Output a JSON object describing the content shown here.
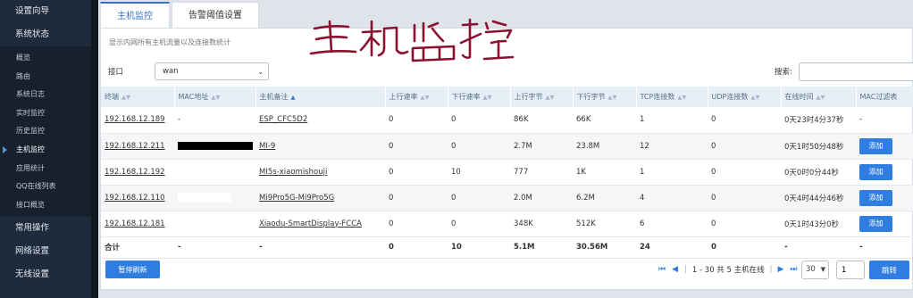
{
  "sidebar": {
    "top": [
      {
        "label": "设置向导"
      },
      {
        "label": "系统状态"
      }
    ],
    "subs": [
      {
        "label": "概览"
      },
      {
        "label": "路由"
      },
      {
        "label": "系统日志"
      },
      {
        "label": "实时监控"
      },
      {
        "label": "历史监控"
      },
      {
        "label": "主机监控"
      },
      {
        "label": "应用统计"
      },
      {
        "label": "QQ在线列表"
      },
      {
        "label": "接口概览"
      }
    ],
    "bottom": [
      {
        "label": "常用操作"
      },
      {
        "label": "网络设置"
      },
      {
        "label": "无线设置"
      }
    ]
  },
  "tabs": [
    "主机监控",
    "告警阈值设置"
  ],
  "description": "显示内网所有主机流量以及连接数统计",
  "handwriting": "主机监控",
  "filter": {
    "interface_label": "接口",
    "interface_value": "wan",
    "search_label": "搜索:",
    "search_value": ""
  },
  "table": {
    "headers": [
      "终端",
      "MAC地址",
      "主机备注",
      "上行速率",
      "下行速率",
      "上行字节",
      "下行字节",
      "TCP连接数",
      "UDP连接数",
      "在线时间",
      "MAC过滤表"
    ],
    "rows": [
      {
        "ip": "192.168.12.189",
        "mac": "-",
        "note": "ESP_CFC5D2",
        "up_rate": "0",
        "down_rate": "0",
        "up_bytes": "86K",
        "down_bytes": "66K",
        "tcp": "1",
        "udp": "0",
        "online": "0天23时4分37秒",
        "filter": "-"
      },
      {
        "ip": "192.168.12.211",
        "mac": "",
        "note": "MI-9",
        "up_rate": "0",
        "down_rate": "0",
        "up_bytes": "2.7M",
        "down_bytes": "23.8M",
        "tcp": "12",
        "udp": "0",
        "online": "0天1时50分48秒",
        "filter": "添加"
      },
      {
        "ip": "192.168.12.192",
        "mac": "",
        "note": "MI5s-xiaomishouji",
        "up_rate": "0",
        "down_rate": "10",
        "up_bytes": "777",
        "down_bytes": "1K",
        "tcp": "1",
        "udp": "0",
        "online": "0天0时0分44秒",
        "filter": "添加"
      },
      {
        "ip": "192.168.12.110",
        "mac": "",
        "note": "Mi9Pro5G-Mi9Pro5G",
        "up_rate": "0",
        "down_rate": "0",
        "up_bytes": "2.0M",
        "down_bytes": "6.2M",
        "tcp": "4",
        "udp": "0",
        "online": "0天4时44分46秒",
        "filter": "添加"
      },
      {
        "ip": "192.168.12.181",
        "mac": "",
        "note": "Xiaodu-SmartDisplay-FCCA",
        "up_rate": "0",
        "down_rate": "0",
        "up_bytes": "348K",
        "down_bytes": "512K",
        "tcp": "6",
        "udp": "0",
        "online": "0天1时43分0秒",
        "filter": "添加"
      }
    ],
    "total": {
      "label": "合计",
      "mac": "-",
      "note": "-",
      "up_rate": "0",
      "down_rate": "10",
      "up_bytes": "5.1M",
      "down_bytes": "30.56M",
      "tcp": "24",
      "udp": "0",
      "online": "-",
      "filter": "-"
    }
  },
  "pause_label": "暂停刷新",
  "pager": {
    "info": "1 - 30 共 5 主机在线",
    "page_size": "30",
    "page": "1",
    "go_label": "跳转"
  },
  "colors": {
    "accent": "#2f7de1",
    "sidebar": "#1e2b3d",
    "header_bg": "#e6eef7",
    "handwriting": "#8a1230"
  }
}
